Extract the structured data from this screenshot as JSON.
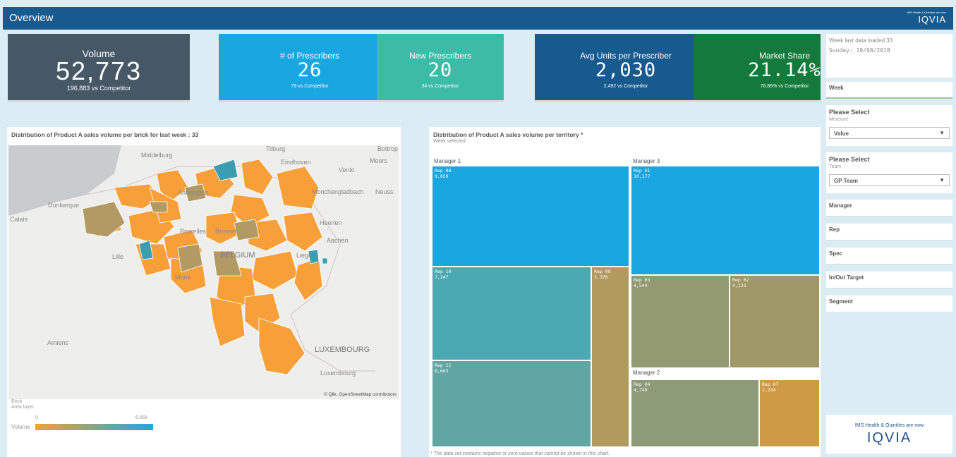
{
  "header": {
    "title": "Overview",
    "logo_tagline": "IMS Health & Quintiles are now",
    "logo_name": "IQVIA"
  },
  "kpis": [
    {
      "label": "Volume",
      "value": "52,773",
      "sub": "196,883 vs Competitor",
      "color": "#465766"
    },
    {
      "label": "# of Prescribers",
      "value": "26",
      "sub": "79 vs Competitor",
      "color": "#1aa6e0"
    },
    {
      "label": "New Prescribers",
      "value": "20",
      "sub": "34 vs Competitor",
      "color": "#3cbca7"
    },
    {
      "label": "Avg Units per Prescriber",
      "value": "2,030",
      "sub": "2,492 vs Competitor",
      "color": "#175a8e"
    },
    {
      "label": "Market Share",
      "value": "21.14%",
      "sub": "78.86% vs Competitor",
      "color": "#147a3c"
    }
  ],
  "map_panel": {
    "title": "Distribution of Product A sales volume per brick for last week : 33",
    "cities": [
      "Tilburg",
      "Bottrop",
      "Middelburg",
      "Eindhoven",
      "Moers",
      "Venlo",
      "Antwerpen",
      "Dunkerque",
      "Monchengladbach",
      "Neuss",
      "Calais",
      "Bruxelles",
      "Brussel",
      "Heerlen",
      "Aachen",
      "Lille",
      "BELGIUM",
      "Liege",
      "Mons",
      "Amiens",
      "LUXEMBOURG",
      "Luxembourg"
    ],
    "attribution": "© Qlik, OpenStreetMap contributors",
    "legend": {
      "layer_name": "Brick",
      "layer_type": "Area layer",
      "measure": "Volume",
      "min": "0",
      "max": "6.66k",
      "color_low": "#f5a032",
      "color_high": "#1aa9e0"
    }
  },
  "treemap_panel": {
    "title": "Distribution of Product A sales volume per territory *",
    "subtitle": "Week selected",
    "footnote": "* The data set contains negative or zero values that cannot be shown in this chart.",
    "managers": [
      {
        "name": "Manager 1",
        "reps": [
          {
            "name": "Rep 08",
            "value": "9,659",
            "color": "#1aa6e0"
          },
          {
            "name": "Rep 10",
            "value": "7,247",
            "color": "#4aa9b2"
          },
          {
            "name": "Rep 11",
            "value": "6,663",
            "color": "#62a6a4"
          },
          {
            "name": "Rep 09",
            "value": "3,378",
            "color": "#b09a5e"
          }
        ]
      },
      {
        "name": "Manager 3",
        "reps": [
          {
            "name": "Rep 01",
            "value": "10,177",
            "color": "#1aa6e0"
          },
          {
            "name": "Rep 03",
            "value": "4,544",
            "color": "#939a72"
          },
          {
            "name": "Rep 02",
            "value": "4,123",
            "color": "#a09866"
          }
        ]
      },
      {
        "name": "Manager 2",
        "reps": [
          {
            "name": "Rep 04",
            "value": "4,749",
            "color": "#8e9b78"
          },
          {
            "name": "Rep 07",
            "value": "2,234",
            "color": "#cf9a46"
          }
        ]
      }
    ]
  },
  "sidebar": {
    "loaded_text": "Week last data loaded 33",
    "loaded_date": "Sunday: 19/08/2018",
    "week_label": "Week",
    "measure": {
      "title": "Please Select",
      "subtitle": "Measure",
      "value": "Value"
    },
    "team": {
      "title": "Please Select",
      "subtitle": "Team",
      "value": "GP Team"
    },
    "filters": [
      "Manager",
      "Rep",
      "Spec",
      "In/Out Target",
      "Segment"
    ],
    "logo_tagline": "IMS Health & Quintiles are now",
    "logo_name": "IQVIA"
  }
}
